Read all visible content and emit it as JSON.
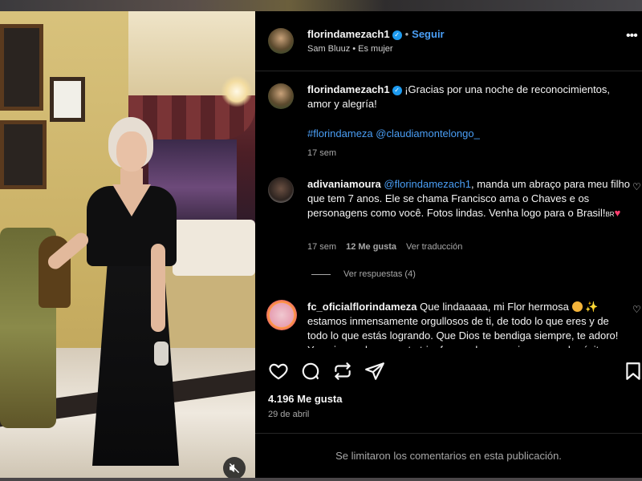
{
  "post": {
    "author": "florindamezach1",
    "follow_label": "Seguir",
    "subtitle": "Sam Bluuz • Es mujer",
    "more_label": "•••"
  },
  "caption": {
    "username": "florindamezach1",
    "text": "¡Gracias por una noche de reconocimientos, amor y alegría!",
    "hashtags": "#florindameza @claudiamontelongo_",
    "age": "17 sem"
  },
  "comments": [
    {
      "username": "adivaniamoura",
      "mention": "@florindamezach1",
      "text": ", manda um abraço para meu filho que tem 7 anos. Ele se chama Francisco ama o Chaves e os personagens como você. Fotos lindas. Venha logo para o Brasil!",
      "flag_text": "BR",
      "age": "17 sem",
      "likes": "12 Me gusta",
      "translate": "Ver traducción",
      "replies": "Ver respuestas (4)"
    },
    {
      "username": "fc_oficialflorindameza",
      "text": "Que lindaaaaa, mi Flor hermosa",
      "text2": "estamos inmensamente orgullosos de ti, de todo lo que eres y de todo lo que estás logrando. Que Dios te bendiga siempre, te adoro! Ya quiero volver a verte triunfar en el escenario con mucho éxito"
    }
  ],
  "stats": {
    "likes": "4.196 Me gusta",
    "date": "29 de abril"
  },
  "footer": {
    "limited": "Se limitaron los comentarios en esta publicación."
  },
  "icons": {
    "verified": "verified-badge-icon",
    "heart": "heart-icon",
    "comment": "comment-icon",
    "repost": "repost-icon",
    "share": "share-icon",
    "save": "bookmark-icon",
    "mute": "mute-icon"
  },
  "colors": {
    "accent": "#4a9ef5",
    "verified": "#1d9bf0",
    "background": "#000000",
    "muted_text": "#a8a8a8"
  }
}
